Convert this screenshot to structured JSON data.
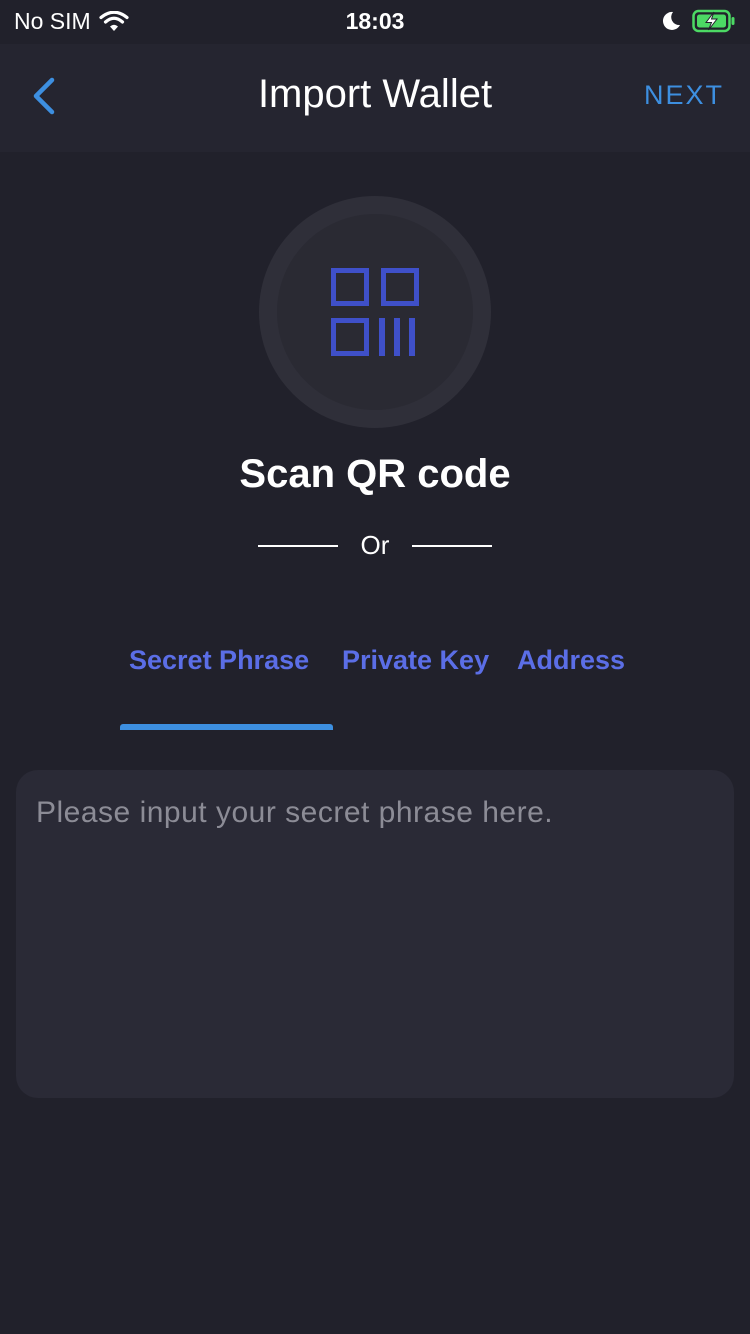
{
  "status_bar": {
    "carrier": "No SIM",
    "time": "18:03",
    "icons": [
      "wifi-icon",
      "moon-icon",
      "battery-charging-icon"
    ]
  },
  "nav": {
    "back_icon": "chevron-left-icon",
    "title": "Import Wallet",
    "next_label": "NEXT"
  },
  "scan": {
    "icon": "qr-code-icon",
    "label": "Scan QR code",
    "or_label": "Or"
  },
  "tabs": [
    {
      "label": "Secret Phrase",
      "selected": true
    },
    {
      "label": "Private Key",
      "selected": false
    },
    {
      "label": "Address",
      "selected": false
    }
  ],
  "input": {
    "value": "",
    "placeholder": "Please input your secret phrase here."
  },
  "colors": {
    "background": "#21212b",
    "navbar": "#252530",
    "accent_blue": "#3d8fe0",
    "tab_text": "#5b6ee6",
    "qr_icon": "#3f50c9",
    "input_bg": "#2a2a36",
    "battery_green": "#4cd964"
  }
}
